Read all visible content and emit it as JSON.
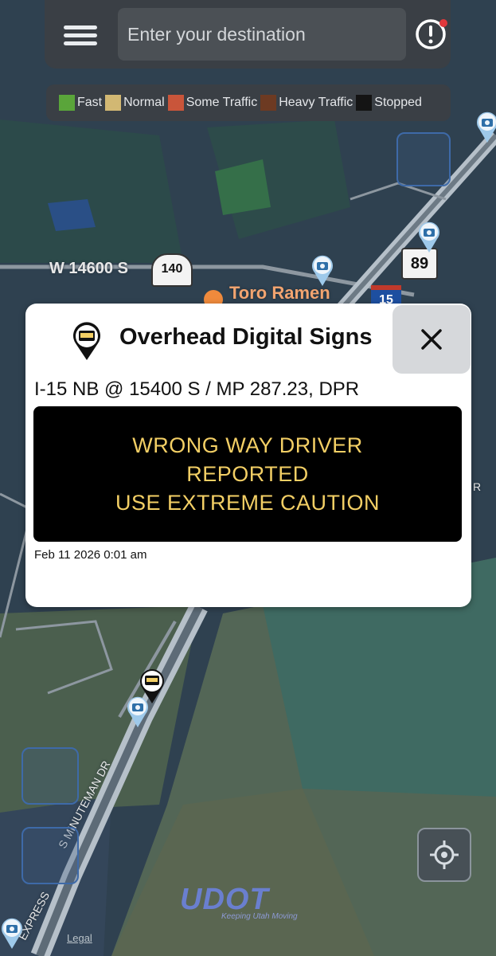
{
  "search": {
    "placeholder": "Enter your destination"
  },
  "legend": [
    {
      "label": "Fast",
      "color": "#5aa53a"
    },
    {
      "label": "Normal",
      "color": "#d2b873"
    },
    {
      "label": "Some Traffic",
      "color": "#c9553a"
    },
    {
      "label": "Heavy Traffic",
      "color": "#6d3a22"
    },
    {
      "label": "Stopped",
      "color": "#141414"
    }
  ],
  "map": {
    "street_label": "W 14600 S",
    "route_shield_1": "140",
    "route_shield_2": "89",
    "interstate_shield": "15",
    "poi_label": "Toro Ramen",
    "road_label_1": "S MINUTEMAN DR",
    "road_label_2": "EXPRESS",
    "edge_label": "R"
  },
  "popup": {
    "title": "Overhead Digital Signs",
    "location": "I-15 NB @ 15400 S / MP 287.23, DPR",
    "message_lines": [
      "WRONG WAY DRIVER",
      "REPORTED",
      "USE EXTREME CAUTION"
    ],
    "timestamp": "Feb 11 2026 0:01 am"
  },
  "footer": {
    "logo_text": "UDOT",
    "logo_tagline": "Keeping Utah Moving",
    "legal_link": "Legal"
  },
  "icons": {
    "menu": "hamburger-icon",
    "alert": "alert-icon",
    "close": "close-icon",
    "locate": "crosshair-icon",
    "camera": "camera-icon",
    "sign": "sign-marker-icon"
  }
}
